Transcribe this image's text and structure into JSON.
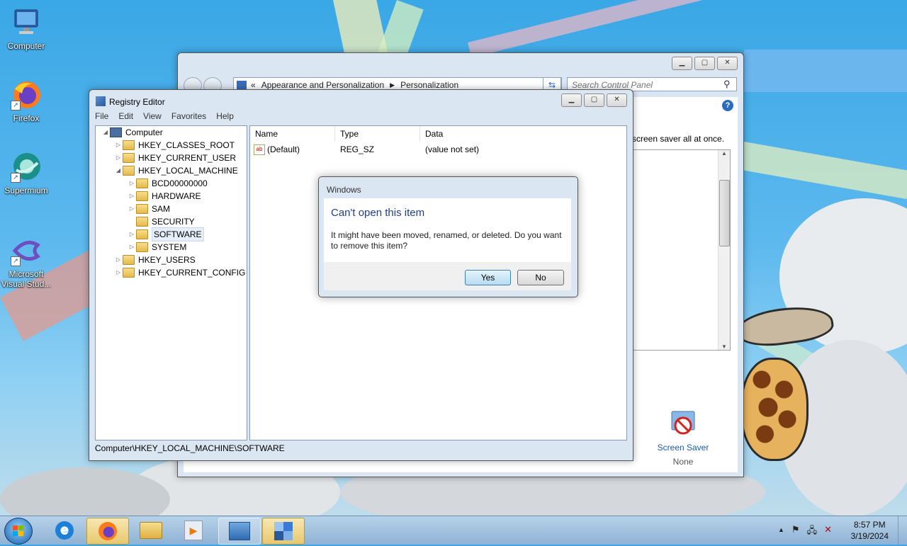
{
  "desktop": {
    "icons": [
      {
        "label": "Computer"
      },
      {
        "label": "Firefox"
      },
      {
        "label": "Supermium"
      },
      {
        "label": "Microsoft Visual Stud..."
      }
    ]
  },
  "control_panel": {
    "breadcrumb_prefix": "«",
    "breadcrumb": [
      "Appearance and Personalization",
      "Personalization"
    ],
    "search_placeholder": "Search Control Panel",
    "text_fragment": "screen saver all at once.",
    "screen_saver": {
      "label": "Screen Saver",
      "value": "None"
    }
  },
  "registry_editor": {
    "title": "Registry Editor",
    "menu": [
      "File",
      "Edit",
      "View",
      "Favorites",
      "Help"
    ],
    "tree": {
      "root": "Computer",
      "hives": [
        "HKEY_CLASSES_ROOT",
        "HKEY_CURRENT_USER",
        "HKEY_LOCAL_MACHINE",
        "HKEY_USERS",
        "HKEY_CURRENT_CONFIG"
      ],
      "hklm_children": [
        "BCD00000000",
        "HARDWARE",
        "SAM",
        "SECURITY",
        "SOFTWARE",
        "SYSTEM"
      ],
      "selected": "SOFTWARE"
    },
    "columns": [
      "Name",
      "Type",
      "Data"
    ],
    "rows": [
      {
        "name": "(Default)",
        "type": "REG_SZ",
        "data": "(value not set)"
      }
    ],
    "status": "Computer\\HKEY_LOCAL_MACHINE\\SOFTWARE"
  },
  "dialog": {
    "title": "Windows",
    "heading": "Can't open this item",
    "message": "It might have been moved, renamed, or deleted. Do you want to remove this item?",
    "yes": "Yes",
    "no": "No"
  },
  "taskbar": {
    "time": "8:57 PM",
    "date": "3/19/2024"
  }
}
